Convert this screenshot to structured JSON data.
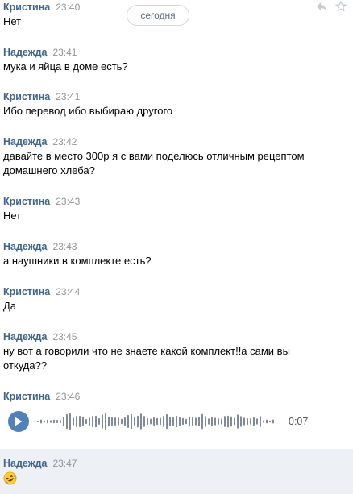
{
  "date_divider": "сегодня",
  "top_icons": [
    "reply-arrow-icon",
    "star-icon"
  ],
  "messages": [
    {
      "author": "Кристина",
      "time": "23:40",
      "text": "Нет"
    },
    {
      "author": "Надежда",
      "time": "23:41",
      "text": "мука и яйца в доме есть?"
    },
    {
      "author": "Кристина",
      "time": "23:41",
      "text": "Ибо перевод ибо выбираю другого"
    },
    {
      "author": "Надежда",
      "time": "23:42",
      "text": "давайте в место 300р я с вами поделюсь отличным рецептом домашнего хлеба?"
    },
    {
      "author": "Кристина",
      "time": "23:43",
      "text": "Нет"
    },
    {
      "author": "Надежда",
      "time": "23:43",
      "text": "а наушники в комплекте есть?"
    },
    {
      "author": "Кристина",
      "time": "23:44",
      "text": "Да"
    },
    {
      "author": "Надежда",
      "time": "23:45",
      "text": "ну вот а говорили что не знаете какой комплект!!а сами вы откуда??"
    },
    {
      "author": "Кристина",
      "time": "23:46",
      "voice_duration": "0:07",
      "voice_icon": "play-icon"
    },
    {
      "author": "Надежда",
      "time": "23:47",
      "emoji": "rolling-on-floor-laughing-emoji"
    }
  ],
  "colors": {
    "author": "#42648b",
    "time": "#939393",
    "play_button": "#5181b8",
    "selected_background": "#edf0f5"
  }
}
